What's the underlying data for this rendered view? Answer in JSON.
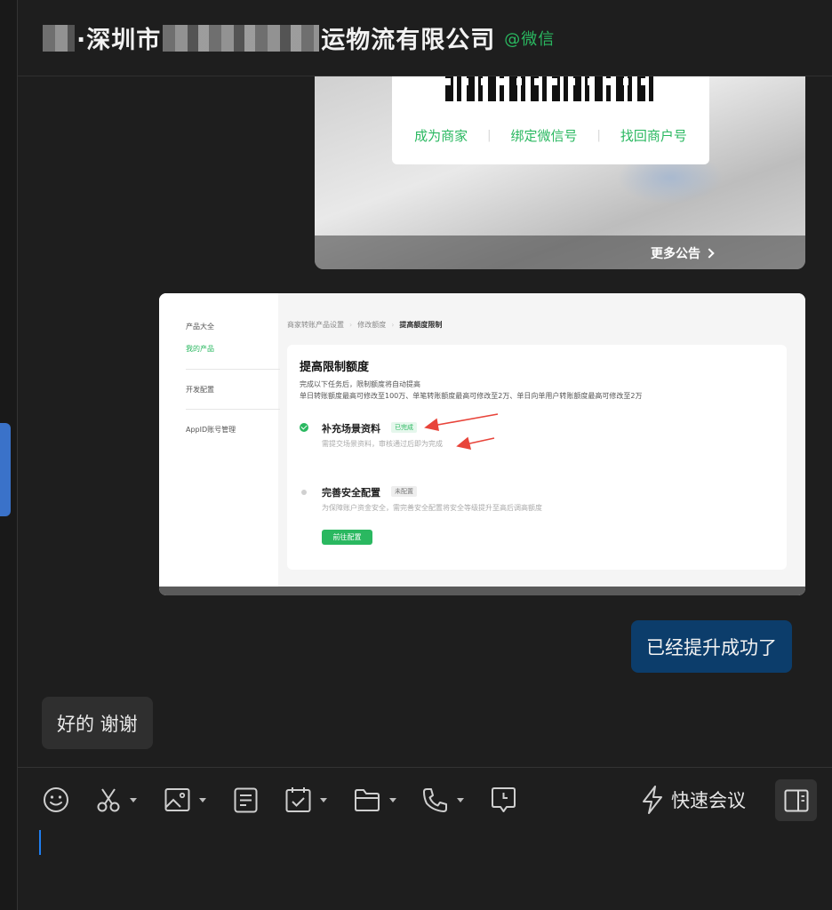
{
  "header": {
    "title_prefix": "·深圳市",
    "title_suffix": "运物流有限公司",
    "tag": "@微信"
  },
  "announcement": {
    "links": [
      "成为商家",
      "绑定微信号",
      "找回商户号"
    ],
    "more": "更多公告"
  },
  "screenshot": {
    "sidebar": [
      "产品大全",
      "我的产品",
      "开发配置",
      "AppID账号管理"
    ],
    "breadcrumb": [
      "商家转账产品设置",
      "修改额度",
      "提高额度限制"
    ],
    "panel_title": "提高限制额度",
    "desc_line1": "完成以下任务后，限制额度将自动提高",
    "desc_line2": "单日转账额度最高可修改至100万、单笔转账额度最高可修改至2万、单日向单用户转账额度最高可修改至2万",
    "step1": {
      "name": "补充场景资料",
      "badge": "已完成",
      "hint": "需提交场景资料，审核通过后即为完成"
    },
    "step2": {
      "name": "完善安全配置",
      "badge": "未配置",
      "hint": "为保障账户资金安全，需完善安全配置将安全等级提升至高后调高额度"
    },
    "button": "前往配置"
  },
  "messages": {
    "outgoing": "已经提升成功了",
    "incoming": "好的 谢谢"
  },
  "toolbar": {
    "quick_meeting": "快速会议",
    "icons": [
      "emoji-icon",
      "scissors-icon",
      "image-icon",
      "document-icon",
      "task-icon",
      "folder-icon",
      "phone-icon",
      "reminder-icon",
      "lightning-icon",
      "side-panel-icon"
    ]
  },
  "colors": {
    "accent_green": "#2ab860",
    "outgoing_bubble": "#0c3d6b",
    "incoming_bubble": "#2f2f2f",
    "cursor": "#1f7ef0"
  }
}
